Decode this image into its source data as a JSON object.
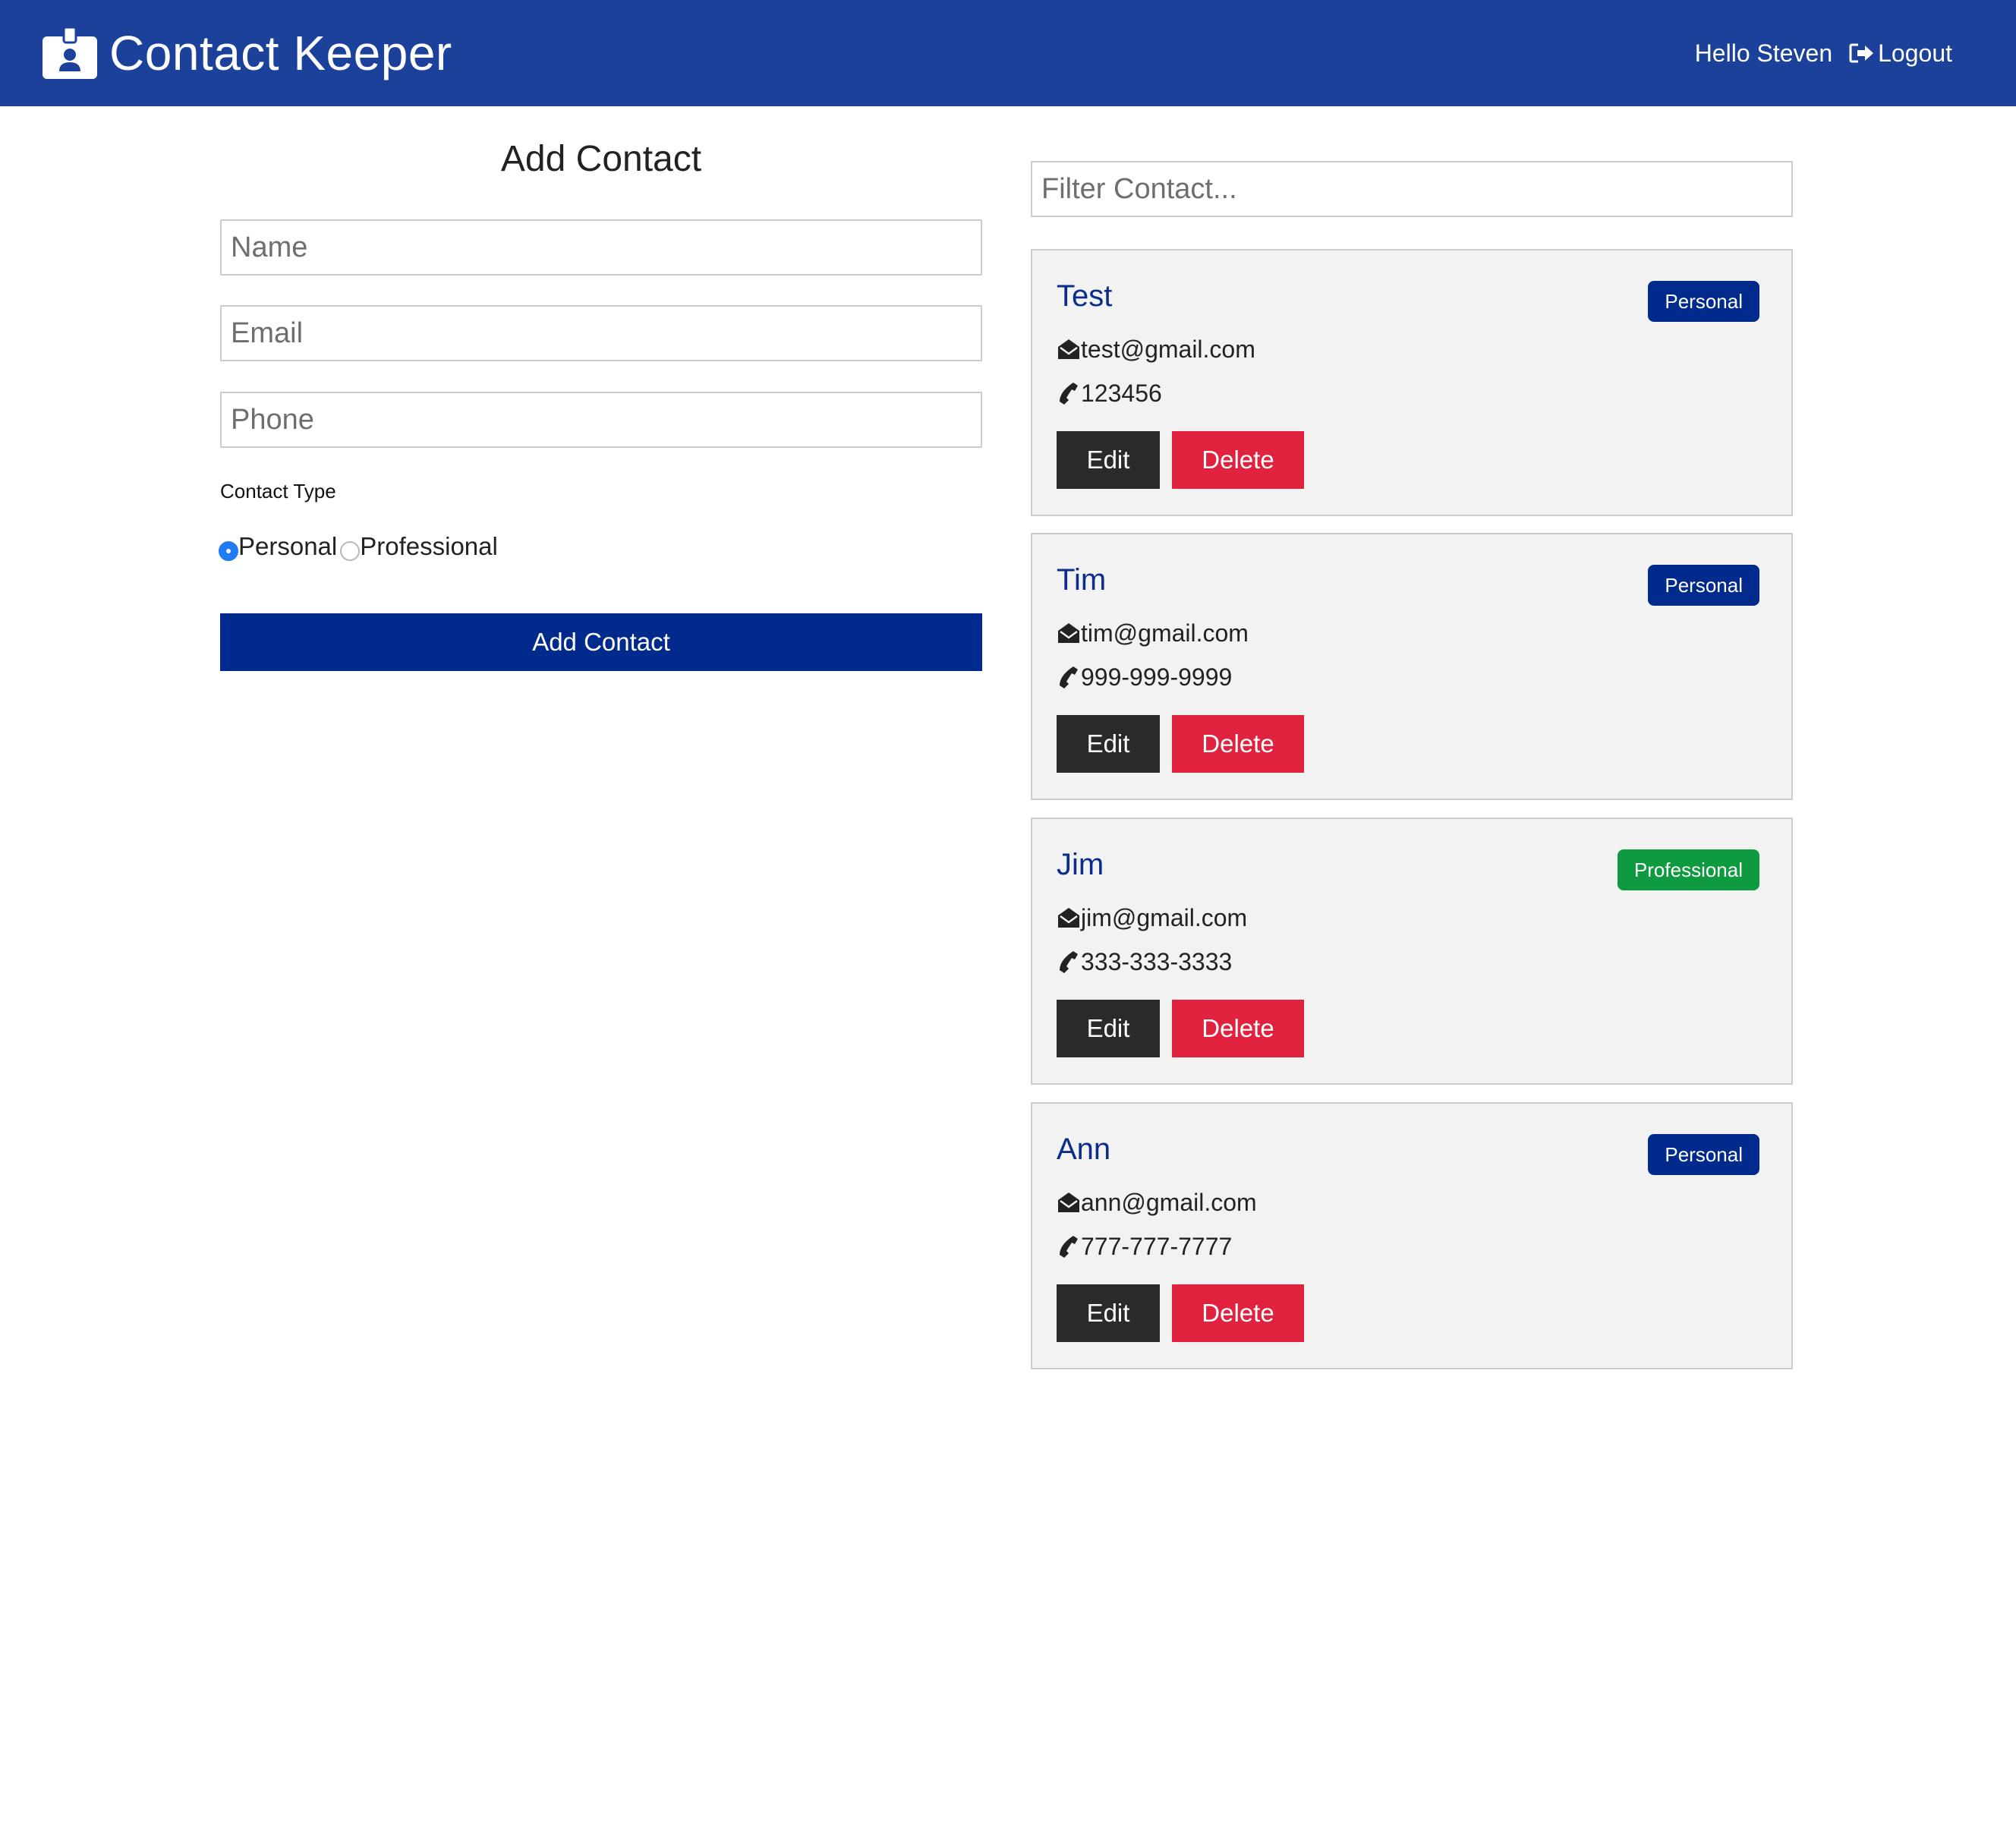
{
  "navbar": {
    "title": "Contact Keeper",
    "brand_icon": "id-badge-icon",
    "greeting": "Hello Steven",
    "logout_label": "Logout",
    "logout_icon": "sign-out-icon",
    "background_color": "#1b419b"
  },
  "form": {
    "title": "Add Contact",
    "name_placeholder": "Name",
    "email_placeholder": "Email",
    "phone_placeholder": "Phone",
    "contact_type_label": "Contact Type",
    "options": [
      {
        "label": "Personal",
        "checked": true
      },
      {
        "label": "Professional",
        "checked": false
      }
    ],
    "submit_label": "Add Contact",
    "submit_color": "#002b8c"
  },
  "filter": {
    "placeholder": "Filter Contact..."
  },
  "contacts": [
    {
      "name": "Test",
      "type": "Personal",
      "email": "test@gmail.com",
      "phone": "123456",
      "edit_label": "Edit",
      "delete_label": "Delete"
    },
    {
      "name": "Tim",
      "type": "Personal",
      "email": "tim@gmail.com",
      "phone": "999-999-9999",
      "edit_label": "Edit",
      "delete_label": "Delete"
    },
    {
      "name": "Jim",
      "type": "Professional",
      "email": "jim@gmail.com",
      "phone": "333-333-3333",
      "edit_label": "Edit",
      "delete_label": "Delete"
    },
    {
      "name": "Ann",
      "type": "Personal",
      "email": "ann@gmail.com",
      "phone": "777-777-7777",
      "edit_label": "Edit",
      "delete_label": "Delete"
    }
  ],
  "colors": {
    "personal_badge": "#002b8c",
    "professional_badge": "#0e9a3e",
    "edit_button": "#2a2a2a",
    "delete_button": "#e0223f",
    "contact_name": "#0b2d8a"
  },
  "icons": {
    "email": "envelope-open-icon",
    "phone": "phone-icon"
  }
}
